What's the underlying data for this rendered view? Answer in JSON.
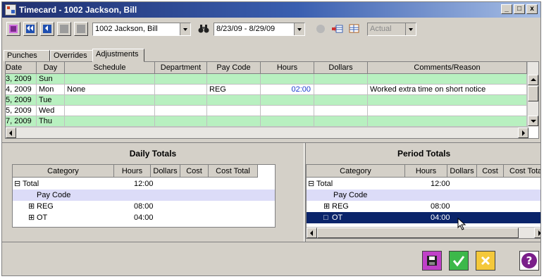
{
  "window": {
    "title": "Timecard - 1002 Jackson, Bill",
    "minimize": "_",
    "restore": "□",
    "close": "x"
  },
  "toolbar": {
    "employee": "1002 Jackson, Bill",
    "date_range": "8/23/09 - 8/29/09",
    "view": "Actual"
  },
  "tabs": [
    "Punches",
    "Overrides",
    "Adjustments"
  ],
  "grid": {
    "columns": [
      "Date",
      "Day",
      "Schedule",
      "Department",
      "Pay Code",
      "Hours",
      "Dollars",
      "Comments/Reason"
    ],
    "rows": [
      {
        "date": "3, 2009",
        "day": "Sun",
        "schedule": "",
        "department": "",
        "pay_code": "",
        "hours": "",
        "dollars": "",
        "comments": ""
      },
      {
        "date": "4, 2009",
        "day": "Mon",
        "schedule": "None",
        "department": "",
        "pay_code": "REG",
        "hours": "02:00",
        "dollars": "",
        "comments": "Worked extra time on short notice"
      },
      {
        "date": "5, 2009",
        "day": "Tue",
        "schedule": "",
        "department": "",
        "pay_code": "",
        "hours": "",
        "dollars": "",
        "comments": ""
      },
      {
        "date": "5, 2009",
        "day": "Wed",
        "schedule": "",
        "department": "",
        "pay_code": "",
        "hours": "",
        "dollars": "",
        "comments": ""
      },
      {
        "date": "7, 2009",
        "day": "Thu",
        "schedule": "",
        "department": "",
        "pay_code": "",
        "hours": "",
        "dollars": "",
        "comments": ""
      }
    ]
  },
  "daily_totals": {
    "title": "Daily Totals",
    "columns": [
      "Category",
      "Hours",
      "Dollars",
      "Cost",
      "Cost Total"
    ],
    "rows": [
      {
        "expander": "⊟",
        "label": "Total",
        "hours": "12:00"
      },
      {
        "expander": "",
        "label": "Pay Code",
        "hours": ""
      },
      {
        "expander": "⊞",
        "label": "REG",
        "hours": "08:00"
      },
      {
        "expander": "⊞",
        "label": "OT",
        "hours": "04:00"
      }
    ]
  },
  "period_totals": {
    "title": "Period Totals",
    "columns": [
      "Category",
      "Hours",
      "Dollars",
      "Cost",
      "Cost Total"
    ],
    "rows": [
      {
        "expander": "⊟",
        "label": "Total",
        "hours": "12:00"
      },
      {
        "expander": "",
        "label": "Pay Code",
        "hours": ""
      },
      {
        "expander": "⊞",
        "label": "REG",
        "hours": "08:00"
      },
      {
        "expander": "□",
        "label": "OT",
        "hours": "04:00"
      }
    ]
  },
  "icons": {
    "save": "save-icon",
    "first": "first-record-icon",
    "prev": "previous-record-icon",
    "find": "binoculars-icon",
    "ok": "checkmark-icon",
    "cancel": "cancel-icon",
    "help": "question-mark-icon"
  },
  "colors": {
    "row_green": "#b8f0c0",
    "row_lavender": "#dcdcf8",
    "selection": "#0a246a",
    "hours_blue": "#1a3ad0"
  }
}
